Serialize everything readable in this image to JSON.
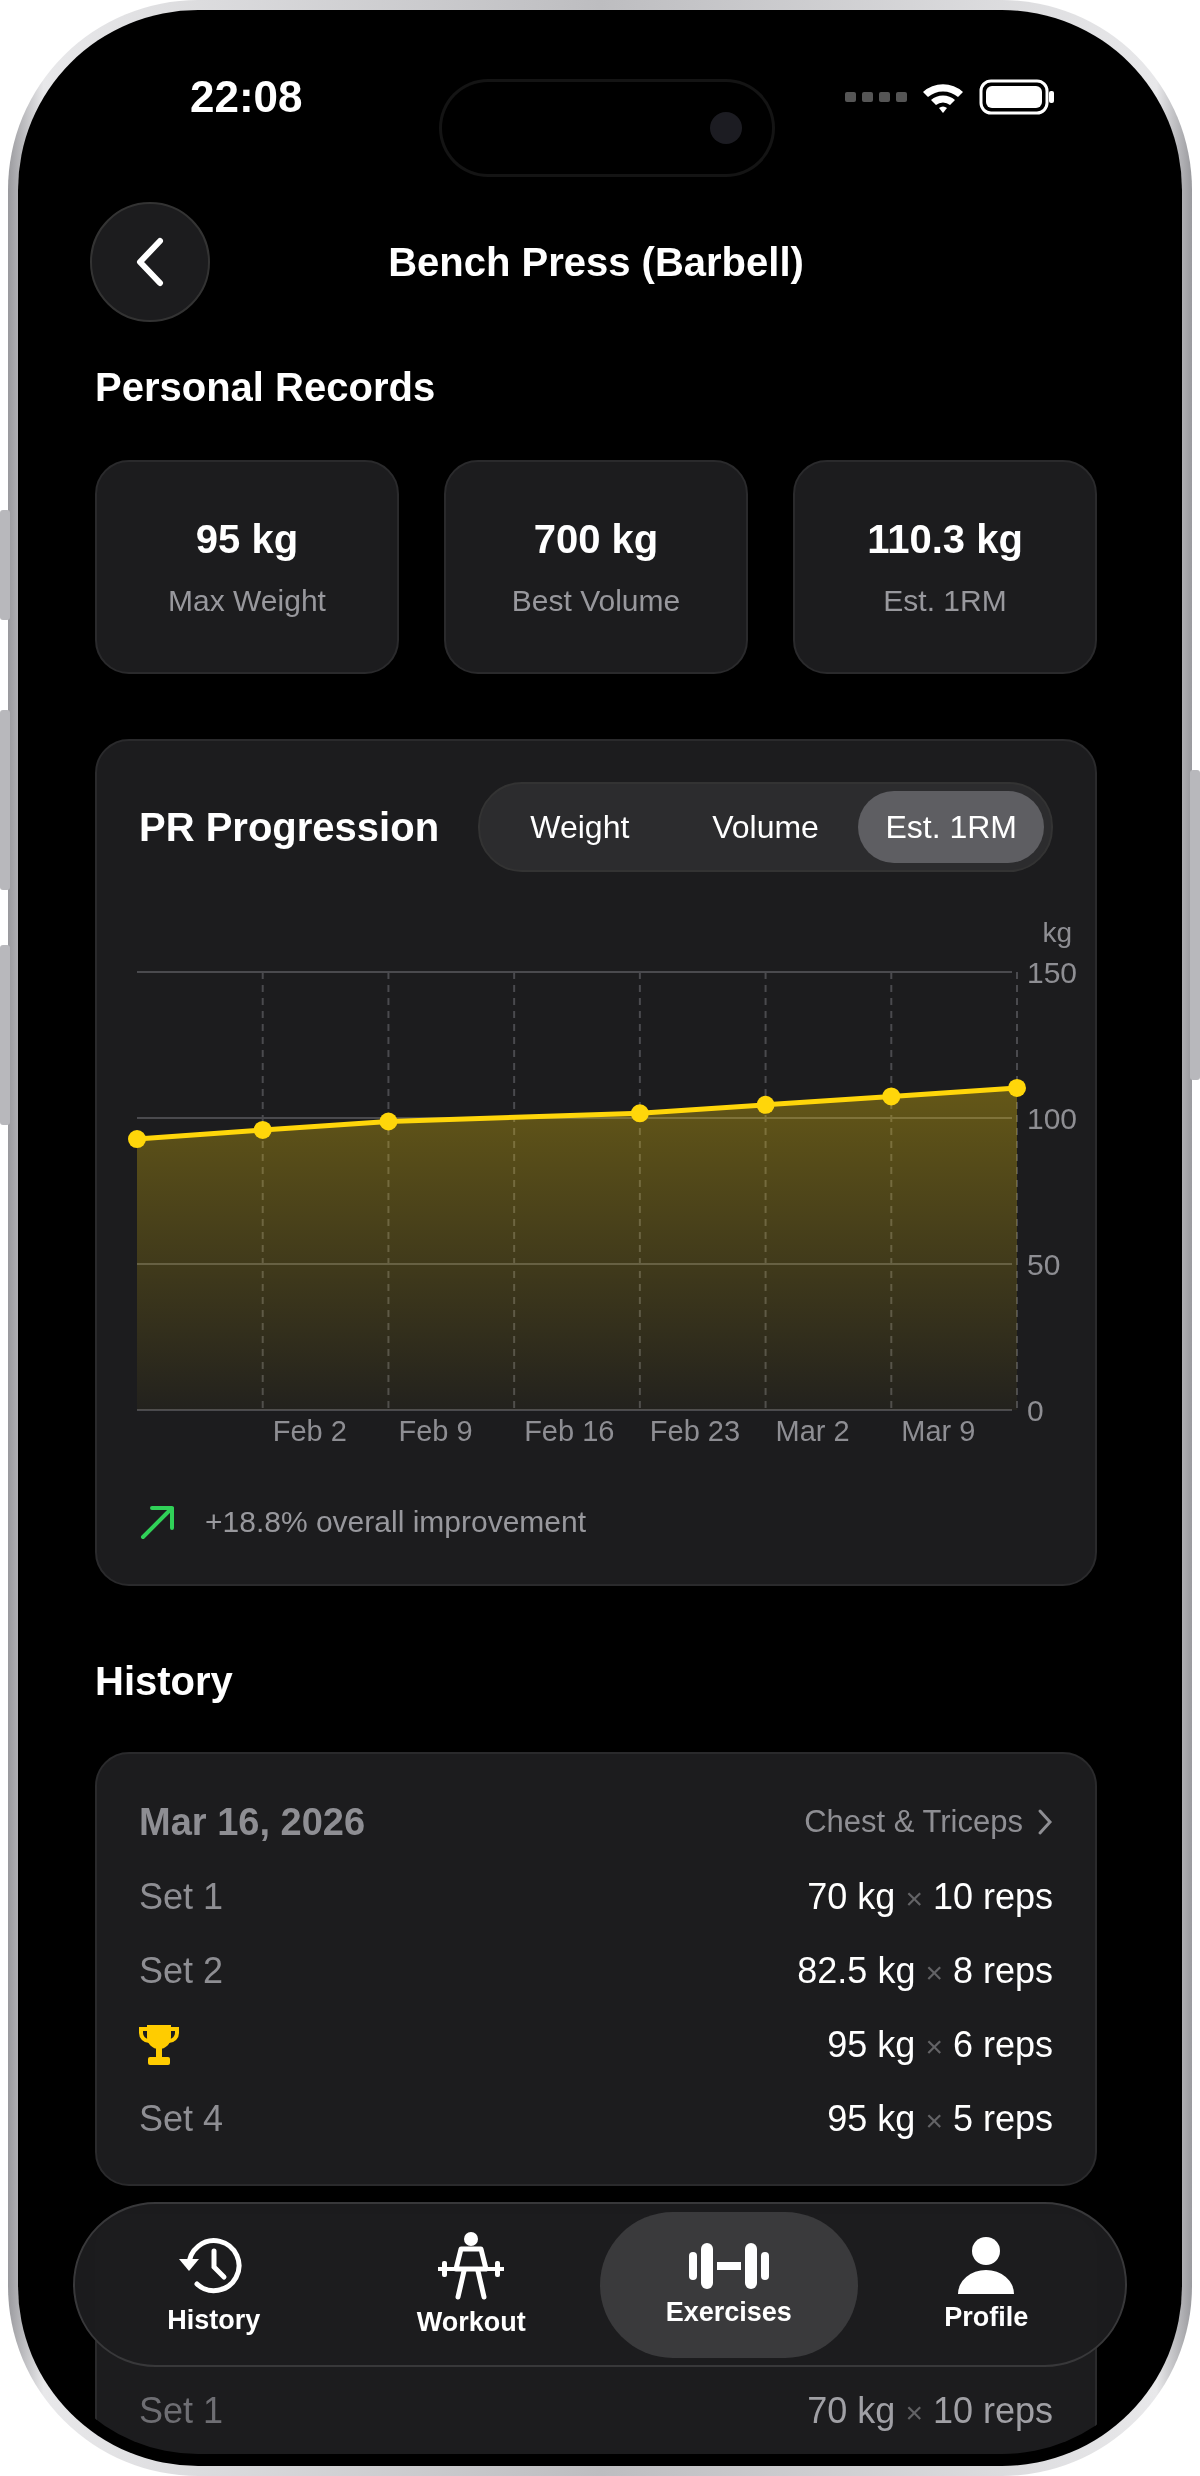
{
  "status_bar": {
    "time": "22:08"
  },
  "header": {
    "title": "Bench Press (Barbell)"
  },
  "personal_records": {
    "title": "Personal Records",
    "cards": [
      {
        "value": "95 kg",
        "label": "Max Weight"
      },
      {
        "value": "700 kg",
        "label": "Best Volume"
      },
      {
        "value": "110.3 kg",
        "label": "Est. 1RM"
      }
    ]
  },
  "progression": {
    "title": "PR Progression",
    "tabs": [
      {
        "label": "Weight",
        "selected": false
      },
      {
        "label": "Volume",
        "selected": false
      },
      {
        "label": "Est. 1RM",
        "selected": true
      }
    ],
    "chart_data": {
      "type": "area",
      "ylabel": "kg",
      "categories": [
        null,
        "Feb 2",
        "Feb 9",
        "Feb 16",
        "Feb 23",
        "Mar 2",
        "Mar 9",
        null
      ],
      "series": [
        {
          "color": "#ffd60a",
          "values": [
            92.8,
            95.9,
            98.8,
            null,
            101.6,
            104.5,
            107.4,
            110.3
          ]
        }
      ],
      "ylim": [
        0,
        150
      ],
      "yticks": [
        0,
        50,
        100,
        150
      ]
    },
    "improvement": "+18.8% overall improvement"
  },
  "history": {
    "title": "History",
    "sessions": [
      {
        "date": "Mar 16, 2026",
        "workout": "Chest & Triceps",
        "sets": [
          {
            "kind": "set",
            "label": "Set 1",
            "weight": "70 kg",
            "times": "×",
            "reps": "10 reps"
          },
          {
            "kind": "set",
            "label": "Set 2",
            "weight": "82.5 kg",
            "times": "×",
            "reps": "8 reps"
          },
          {
            "kind": "record",
            "weight": "95 kg",
            "times": "×",
            "reps": "6 reps"
          },
          {
            "kind": "set",
            "label": "Set 4",
            "weight": "95 kg",
            "times": "×",
            "reps": "5 reps"
          }
        ]
      },
      {
        "sets": [
          {
            "kind": "set",
            "label": "Set 1",
            "weight": "70 kg",
            "times": "×",
            "reps": "10 reps"
          }
        ]
      }
    ]
  },
  "tab_bar": {
    "items": [
      {
        "kind": "history",
        "label": "History",
        "selected": false
      },
      {
        "kind": "workout",
        "label": "Workout",
        "selected": false
      },
      {
        "kind": "exercises",
        "label": "Exercises",
        "selected": true
      },
      {
        "kind": "profile",
        "label": "Profile",
        "selected": false
      }
    ]
  }
}
